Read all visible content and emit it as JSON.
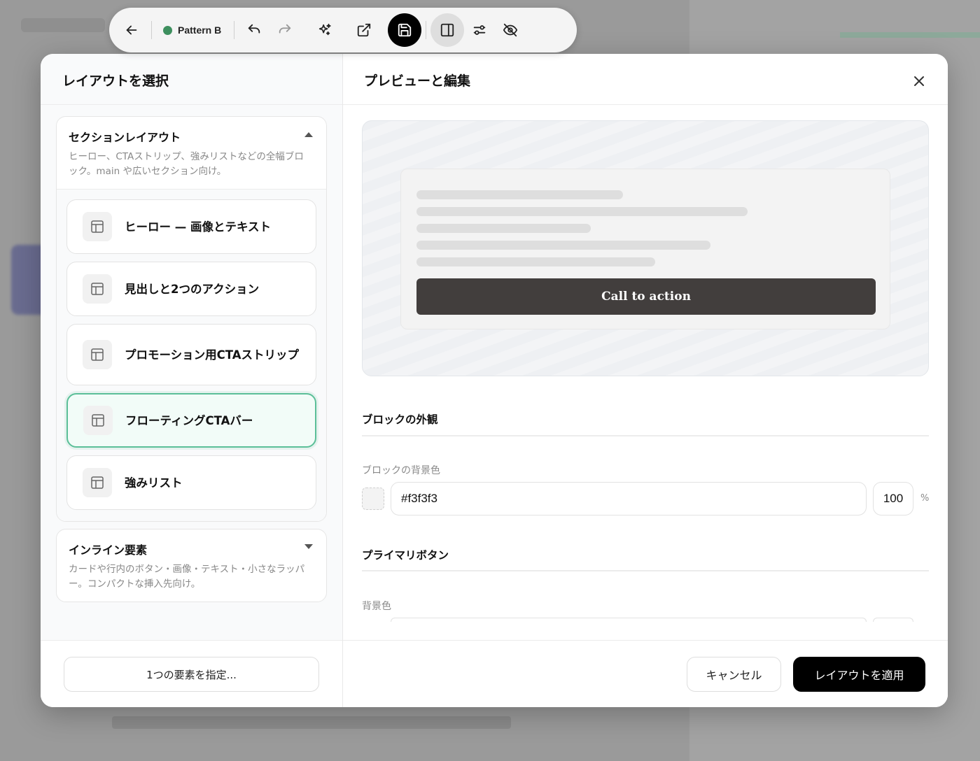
{
  "toolbar": {
    "status_label": "Pattern B",
    "status_color": "#3d8f5e",
    "icons": [
      "arrow-left-icon",
      "undo-icon",
      "redo-icon",
      "sparkles-icon",
      "external-link-icon",
      "save-icon",
      "panel-icon",
      "sliders-icon",
      "eye-off-icon"
    ]
  },
  "left": {
    "title": "レイアウトを選択",
    "groups": [
      {
        "title": "セクションレイアウト",
        "description": "ヒーロー、CTAストリップ、強みリストなどの全幅ブロック。main や広いセクション向け。",
        "expanded": true,
        "items": [
          {
            "label": "ヒーロー — 画像とテキスト"
          },
          {
            "label": "見出しと2つのアクション"
          },
          {
            "label": "プロモーション用CTAストリップ"
          },
          {
            "label": "フローティングCTAバー",
            "selected": true
          },
          {
            "label": "強みリスト"
          }
        ]
      },
      {
        "title": "インライン要素",
        "description": "カードや行内のボタン・画像・テキスト・小さなラッパー。コンパクトな挿入先向け。",
        "expanded": false
      }
    ],
    "specify_button": "1つの要素を指定..."
  },
  "right": {
    "title": "プレビューと編集",
    "preview": {
      "cta_label": "Call to action"
    },
    "block_appearance": {
      "title": "ブロックの外観",
      "bg_label": "ブロックの背景色",
      "bg_value": "#f3f3f3",
      "opacity": "100",
      "pct": "%"
    },
    "primary_button": {
      "title": "プライマリボタン",
      "bg_label": "背景色"
    },
    "cancel_button": "キャンセル",
    "apply_button": "レイアウトを適用"
  },
  "colors": {
    "accent": "#5bbf98",
    "primary": "#000000",
    "cta_bg": "#423e3d"
  }
}
